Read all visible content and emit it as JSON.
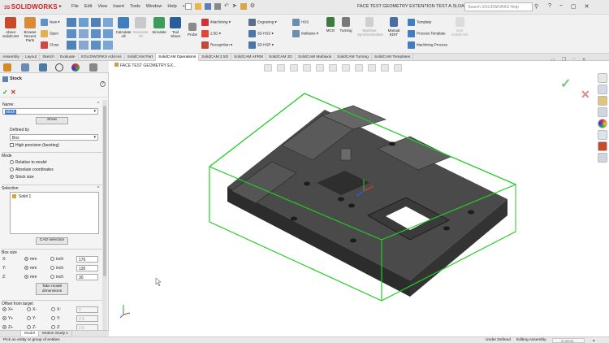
{
  "app": {
    "brand": "SOLIDWORKS",
    "brand_prefix": "3S",
    "window_title": "FACE TEST GEOMETRY EXTENTION TEST A.SLDASM *",
    "menu": [
      "File",
      "Edit",
      "View",
      "Insert",
      "Tools",
      "Window",
      "Help"
    ],
    "search_placeholder": "Search SOLIDWORKS Help",
    "window_controls": [
      "?",
      "−",
      "▢",
      "✕"
    ]
  },
  "ribbon": {
    "about": "About SolidCAM",
    "browse": "Browse Recent Parts",
    "new": "New",
    "open": "Open",
    "close": "Close",
    "calculate_all": "Calculate All",
    "generate_all": "Generate All",
    "simulate": "Simulate",
    "tool_sheet": "Tool Sheet",
    "probe": "Probe",
    "imachining": "iMachining",
    "d25": "2.5D",
    "recognition": "Recognition",
    "engraving": "Engraving",
    "hss_3d": "3D HSS",
    "hsr_3d": "3D HSR",
    "hss": "HSS",
    "multiaxis": "Multiaxis",
    "mco": "MCO",
    "turning": "Turning",
    "machine_synchronization": "Machine Synchronization",
    "manual_edit": "Manual EDIT",
    "template": "Template",
    "process_template": "Process Template",
    "machining_process": "Machining Process",
    "exit": "Exit SolidCAM"
  },
  "command_tabs": [
    "Assembly",
    "Layout",
    "Sketch",
    "Evaluate",
    "SOLIDWORKS Add-Ins",
    "SolidCAM Part",
    "SolidCAM Operations",
    "SolidCAM 2.5D",
    "SolidCAM AFRM",
    "SolidCAM 3D",
    "SolidCAM Multiaxis",
    "SolidCAM Turning",
    "SolidCAM Templates"
  ],
  "active_tab": "SolidCAM Operations",
  "panel": {
    "title": "Stock",
    "name_label": "Name:",
    "name_value": "stock",
    "show_button": "Show",
    "defined_by_label": "Defined by",
    "defined_by_value": "Box",
    "high_precision": "High precision (faceting)",
    "mode_label": "Mode",
    "mode_options": [
      "Relative to model",
      "Absolute coordinates",
      "Stock size"
    ],
    "mode_selected": 2,
    "selection_label": "Selection",
    "selection_item": "Solid 1",
    "cad_selection_button": "CAD selection",
    "box_size_label": "Box size",
    "axes": [
      {
        "axis": "X:",
        "unit1": "mm",
        "unit2": "inch",
        "value": "170"
      },
      {
        "axis": "Y:",
        "unit1": "mm",
        "unit2": "inch",
        "value": "130"
      },
      {
        "axis": "Z:",
        "unit1": "mm",
        "unit2": "inch",
        "value": "30"
      }
    ],
    "take_dims_button_line1": "Take model",
    "take_dims_button_line2": "dimensions",
    "offset_label": "Offset from target",
    "offsets": [
      {
        "a": "X+",
        "b": "X-",
        "c": "X:",
        "value": "2"
      },
      {
        "a": "Y+",
        "b": "Y-",
        "c": "Y:",
        "value": "2.5"
      },
      {
        "a": "Z+",
        "b": "Z-",
        "c": "Z:",
        "value": "2.5"
      }
    ]
  },
  "bottom_tabs": [
    "Model",
    "Motion Study 1"
  ],
  "active_bottom_tab": "Model",
  "viewport": {
    "tree_label": "FACE TEST GEOMETRY EX...",
    "accept_icon_color": "#7cc57c",
    "cancel_icon_color": "#e08a8a"
  },
  "status": {
    "hint": "Pick an entity or group of entities",
    "state": "Under Defined",
    "editing": "Editing Assembly",
    "units": "Custom"
  },
  "colors": {
    "brand_red": "#d42027",
    "stock_box": "#22cc22",
    "model_dark": "#3b3b3b"
  }
}
